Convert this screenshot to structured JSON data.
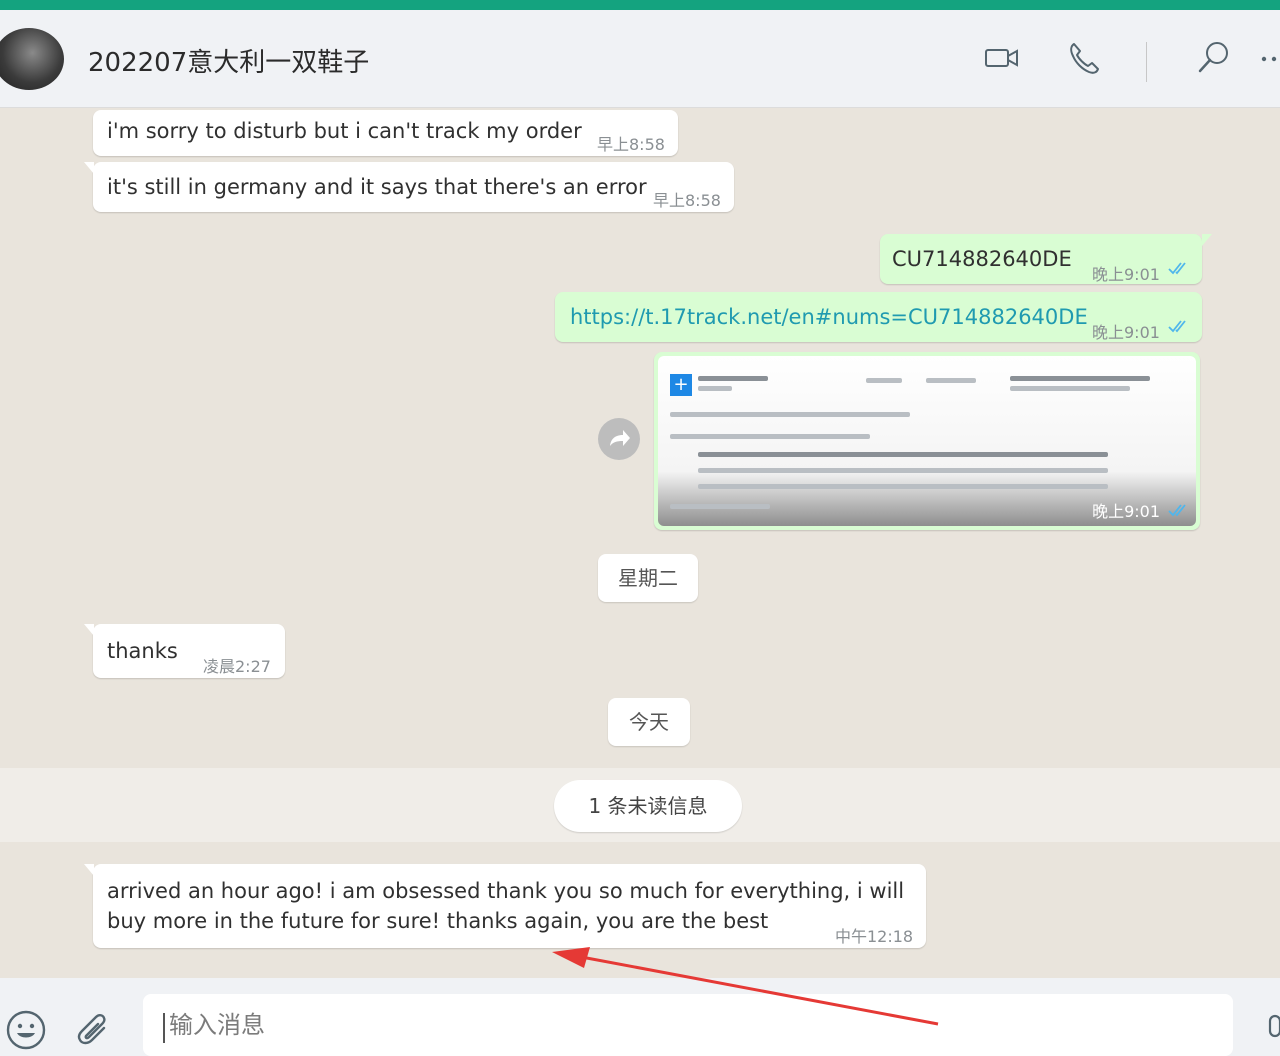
{
  "colors": {
    "accent": "#14a37f",
    "incoming_bubble": "#ffffff",
    "outgoing_bubble": "#d9fdd3",
    "link": "#1f9ab0",
    "read_ticks": "#4fb6ec",
    "annotation_arrow": "#e53935"
  },
  "header": {
    "title": "202207意大利一双鞋子",
    "icons": [
      "video-call-icon",
      "voice-call-icon",
      "search-icon",
      "more-options-icon"
    ]
  },
  "messages": {
    "m1": {
      "text": "i'm sorry to disturb but i can't track my order",
      "time": "早上8:58"
    },
    "m2": {
      "text": "it's still in germany and it says that there's an error",
      "time": "早上8:58"
    },
    "m3": {
      "text": "CU714882640DE",
      "time": "晚上9:01"
    },
    "m4": {
      "text": "https://t.17track.net/en#nums=CU714882640DE",
      "time": "晚上9:01"
    },
    "m5": {
      "time": "晚上9:01"
    },
    "m6": {
      "text": "thanks",
      "time": "凌晨2:27"
    },
    "m7": {
      "line1": "arrived an hour ago! i am obsessed thank you so much for everything, i will",
      "line2": "buy more in the future for sure! thanks again, you are the best",
      "time": "中午12:18"
    }
  },
  "dividers": {
    "tuesday": "星期二",
    "today": "今天",
    "unread": "1 条未读信息"
  },
  "composer": {
    "placeholder": "输入消息",
    "icons": [
      "emoji-icon",
      "attach-icon",
      "microphone-icon"
    ]
  }
}
